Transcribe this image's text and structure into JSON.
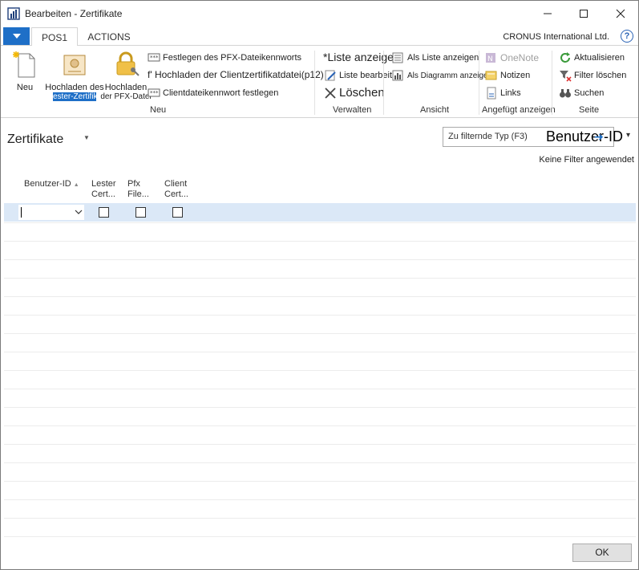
{
  "window": {
    "title": "Bearbeiten - Zertifikate"
  },
  "ribbon_tabs": [
    {
      "label": "POS1"
    },
    {
      "label": "ACTIONS"
    }
  ],
  "company": "CRONUS International Ltd.",
  "groups": {
    "neu": {
      "label": "Neu",
      "new_label": "Neu",
      "upload_cert_label": "Hochladen des",
      "upload_cert_sub": "ester-Zertifika",
      "upload_pfx_label": "Hochladen",
      "upload_pfx_sub": "der PFX-Datei",
      "set_pfx_pw": "Festlegen des PFX-Dateikennworts",
      "upload_client_cert": "f' Hochladen der Clientzertifikatdatei(p12)",
      "set_client_pw": "Clientdateikennwort festlegen"
    },
    "verwalten": {
      "label": "Verwalten",
      "show_list": "*Liste anzeigen",
      "edit_list": "Liste bearbeiten",
      "delete": "Löschen"
    },
    "ansicht": {
      "label": "Ansicht",
      "as_list": "Als Liste anzeigen",
      "as_chart": "Als Diagramm anzeigen"
    },
    "angefuegt": {
      "label": "Angefügt anzeigen",
      "onenote": "OneNote",
      "notes": "Notizen",
      "links": "Links"
    },
    "seite": {
      "label": "Seite",
      "refresh": "Aktualisieren",
      "clear_filter": "Filter löschen",
      "search": "Suchen"
    }
  },
  "page": {
    "title": "Zertifikate",
    "filter_placeholder": "Zu filternde Typ (F3)",
    "filter_field": "Benutzer-ID",
    "no_filter": "Keine Filter angewendet"
  },
  "grid": {
    "columns": [
      {
        "line1": "Benutzer-ID",
        "line2": ""
      },
      {
        "line1": "Lester",
        "line2": "Cert..."
      },
      {
        "line1": "Pfx",
        "line2": "File..."
      },
      {
        "line1": "Client",
        "line2": "Cert..."
      }
    ],
    "rows": [
      {
        "user_id": "",
        "lester_cert": false,
        "pfx_file": false,
        "client_cert": false
      }
    ]
  },
  "footer": {
    "ok_label": "OK"
  },
  "colors": {
    "accent": "#1e6fc7",
    "selected_row": "#dbe8f7"
  }
}
